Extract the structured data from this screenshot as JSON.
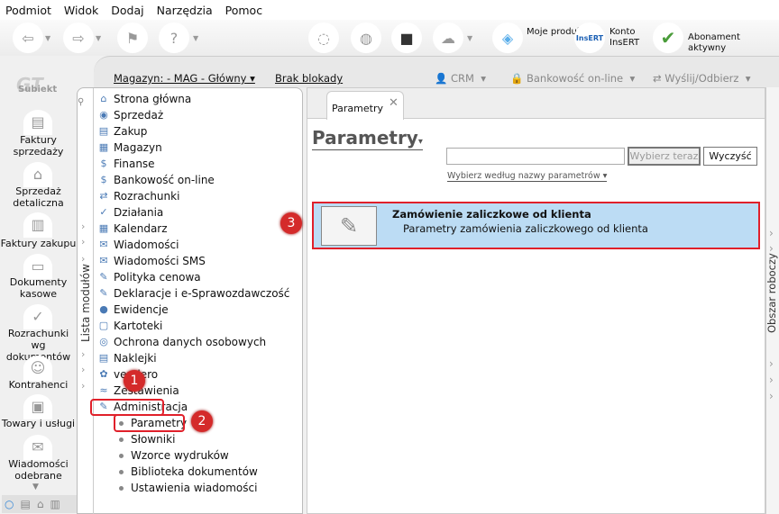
{
  "menu": [
    "Podmiot",
    "Widok",
    "Dodaj",
    "Narzędzia",
    "Pomoc"
  ],
  "toolbar": {
    "moje_produkty": "Moje produkty",
    "konto": "Konto InsERT",
    "abonament": "Abonament aktywny",
    "insert_logo": "InsERT"
  },
  "subbar": {
    "magazyn": "Magazyn: - MAG - Główny",
    "blokada": "Brak blokady",
    "crm": "CRM",
    "bankowosc": "Bankowość on-line",
    "wyslij": "Wyślij/Odbierz"
  },
  "logo": "Subiekt",
  "left": [
    "Faktury sprzedaży",
    "Sprzedaż detaliczna",
    "Faktury zakupu",
    "Dokumenty kasowe",
    "Rozrachunki wg dokumentów",
    "Kontrahenci",
    "Towary i usługi",
    "Wiadomości odebrane"
  ],
  "module_panel": {
    "label": "Lista modułów",
    "items": [
      "Strona główna",
      "Sprzedaż",
      "Zakup",
      "Magazyn",
      "Finanse",
      "Bankowość on-line",
      "Rozrachunki",
      "Działania",
      "Kalendarz",
      "Wiadomości",
      "Wiadomości SMS",
      "Polityka cenowa",
      "Deklaracje i e-Sprawozdawczość",
      "Ewidencje",
      "Kartoteki",
      "Ochrona danych osobowych",
      "Naklejki",
      "vendero",
      "Zestawienia",
      "Administracja"
    ],
    "subitems": [
      "Parametry",
      "Słowniki",
      "Wzorce wydruków",
      "Biblioteka dokumentów",
      "Ustawienia wiadomości"
    ]
  },
  "main": {
    "tab": "Parametry",
    "title": "Parametry",
    "search_value": "",
    "choose_btn": "Wybierz teraz",
    "clear_btn": "Wyczyść",
    "filter": "Wybierz według nazwy parametrów",
    "result": {
      "title": "Zamówienie zaliczkowe od klienta",
      "desc": "Parametry zamówienia zaliczkowego od klienta"
    }
  },
  "right_panel": "Obszar roboczy",
  "badges": [
    "1",
    "2",
    "3"
  ],
  "colors": {
    "highlight": "#e0202a",
    "selected": "#bcdcf4"
  }
}
